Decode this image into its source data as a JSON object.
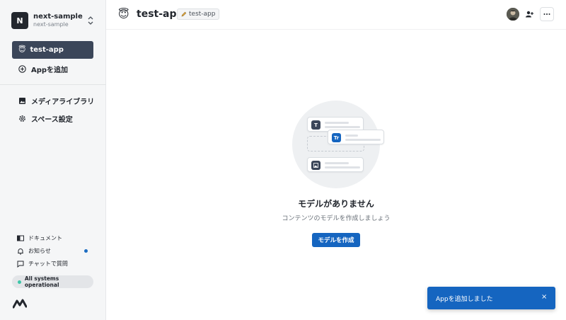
{
  "sidebar": {
    "space": {
      "initial": "N",
      "name": "next-sample",
      "sub": "next-sample"
    },
    "app": {
      "emoji": "😇",
      "label": "test-app"
    },
    "add_app": "Appを追加",
    "items": [
      {
        "label": "メディアライブラリ",
        "icon": "image-icon"
      },
      {
        "label": "スペース設定",
        "icon": "gear-icon"
      }
    ],
    "footer": [
      {
        "label": "ドキュメント",
        "icon": "book-icon"
      },
      {
        "label": "お知らせ",
        "icon": "bell-icon"
      },
      {
        "label": "チャットで質問",
        "icon": "chat-icon"
      }
    ],
    "status": "All systems operational",
    "colors": {
      "active_bg": "#3b4659",
      "status_dot": "#3cc6a8",
      "notif_dot": "#1d6dc2"
    }
  },
  "header": {
    "emoji": "😇",
    "title": "test-app",
    "chip": "test-app"
  },
  "main": {
    "empty_title": "モデルがありません",
    "empty_sub": "コンテンツのモデルを作成しましょう",
    "create_button": "モデルを作成",
    "illustration": {
      "text_icon": "T",
      "rich_icon": "Tr"
    }
  },
  "toast": {
    "message": "Appを追加しました",
    "close": "×"
  },
  "accent": "#1565c0"
}
